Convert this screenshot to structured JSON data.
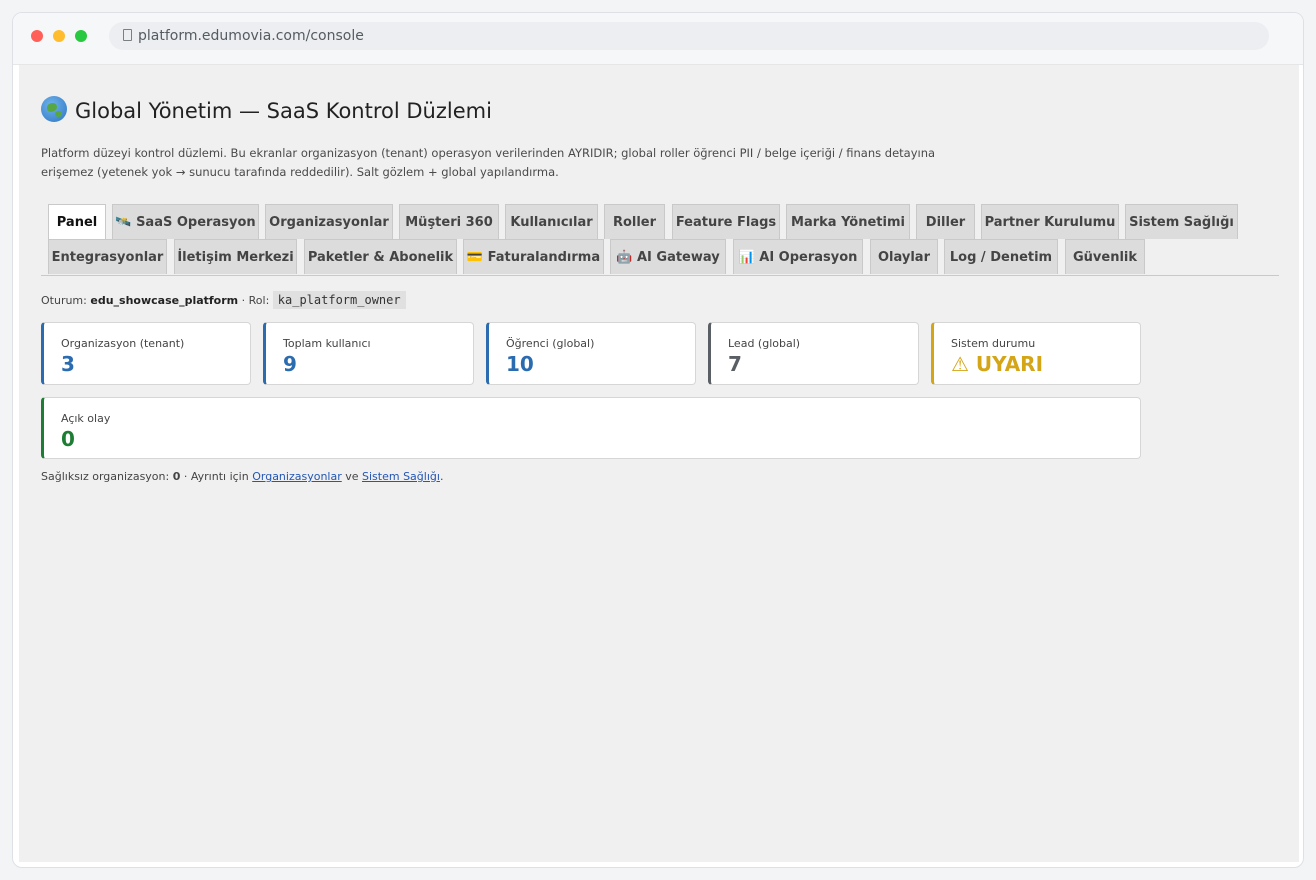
{
  "browser": {
    "url": "platform.edumovia.com/console"
  },
  "header": {
    "title": "Global Yönetim — SaaS Kontrol Düzlemi",
    "icon": "globe-icon",
    "description": "Platform düzeyi kontrol düzlemi. Bu ekranlar organizasyon (tenant) operasyon verilerinden AYRIDIR; global roller öğrenci PII / belge içeriği / finans detayına erişemez (yetenek yok → sunucu tarafında reddedilir). Salt gözlem + global yapılandırma."
  },
  "tabs": {
    "row1": [
      {
        "label": "Panel",
        "active": true
      },
      {
        "label": "🛰️ SaaS Operasyon"
      },
      {
        "label": "Organizasyonlar"
      },
      {
        "label": "Müşteri 360"
      },
      {
        "label": "Kullanıcılar"
      },
      {
        "label": "Roller"
      },
      {
        "label": "Feature Flags"
      },
      {
        "label": "Marka Yönetimi"
      },
      {
        "label": "Diller"
      },
      {
        "label": "Partner Kurulumu"
      },
      {
        "label": "Sistem Sağlığı"
      }
    ],
    "row2": [
      {
        "label": "Entegrasyonlar"
      },
      {
        "label": "İletişim Merkezi"
      },
      {
        "label": "Paketler & Abonelik"
      },
      {
        "label": "💳 Faturalandırma"
      },
      {
        "label": "🤖 AI Gateway"
      },
      {
        "label": "📊 AI Operasyon"
      },
      {
        "label": "Olaylar"
      },
      {
        "label": "Log / Denetim"
      },
      {
        "label": "Güvenlik"
      }
    ]
  },
  "session": {
    "prefix": "Oturum:",
    "user": "edu_showcase_platform",
    "role_prefix": "· Rol:",
    "role": "ka_platform_owner"
  },
  "stats": [
    {
      "label": "Organizasyon (tenant)",
      "value": "3",
      "color": "#2b6cb0"
    },
    {
      "label": "Toplam kullanıcı",
      "value": "9",
      "color": "#2b6cb0"
    },
    {
      "label": "Öğrenci (global)",
      "value": "10",
      "color": "#2b6cb0"
    },
    {
      "label": "Lead (global)",
      "value": "7",
      "color": "#5a5f66"
    },
    {
      "label": "Sistem durumu",
      "value": "⚠ UYARI",
      "color": "#d4a516"
    }
  ],
  "incidents": {
    "label": "Açık olay",
    "value": "0",
    "color": "#1e7d34"
  },
  "footer": {
    "prefix": "Sağlıksız organizasyon:",
    "count": "0",
    "middle": "· Ayrıntı için",
    "link1": "Organizasyonlar",
    "and": "ve",
    "link2": "Sistem Sağlığı",
    "end": "."
  }
}
